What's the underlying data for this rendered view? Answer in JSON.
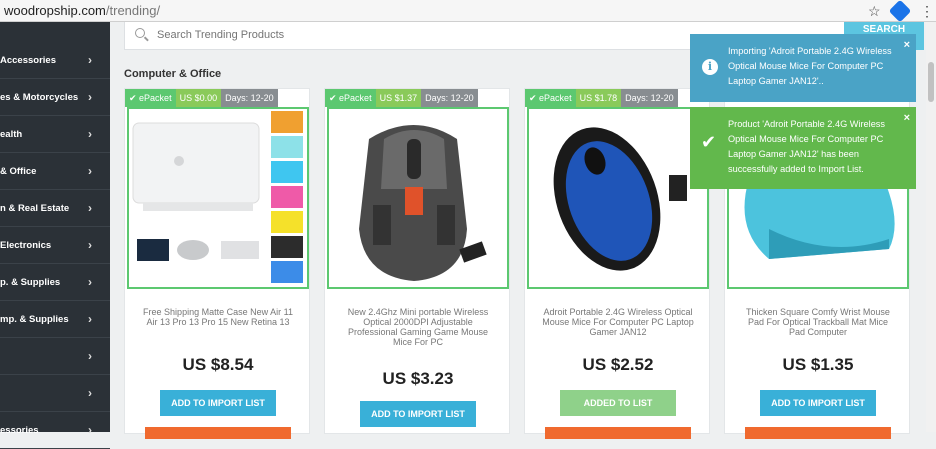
{
  "browser": {
    "url_host": "woodropship.com",
    "url_path": "/trending/",
    "star_icon": "star-icon",
    "menu_icon": "kebab-menu-icon"
  },
  "sidebar": {
    "items": [
      {
        "label": "Accessories"
      },
      {
        "label": "es & Motorcycles"
      },
      {
        "label": "ealth"
      },
      {
        "label": "& Office"
      },
      {
        "label": "n & Real Estate"
      },
      {
        "label": "Electronics"
      },
      {
        "label": "p. & Supplies"
      },
      {
        "label": "mp. & Supplies"
      },
      {
        "label": ""
      },
      {
        "label": ""
      },
      {
        "label": "essories"
      }
    ]
  },
  "search": {
    "placeholder": "Search Trending Products",
    "button_label": "SEARCH"
  },
  "section_title": "Computer & Office",
  "products": [
    {
      "epacket": "ePacket",
      "ship_price": "US $0.00",
      "days": "Days: 12-20",
      "name": "Free Shipping Matte Case New Air 11 Air 13 Pro 13 Pro 15 New Retina 13",
      "price": "US $8.54",
      "button": "ADD TO IMPORT LIST"
    },
    {
      "epacket": "ePacket",
      "ship_price": "US $1.37",
      "days": "Days: 12-20",
      "name": "New 2.4Ghz Mini portable Wireless Optical 2000DPI Adjustable Professional Gaming Game Mouse Mice For PC",
      "price": "US $3.23",
      "button": "ADD TO IMPORT LIST"
    },
    {
      "epacket": "ePacket",
      "ship_price": "US $1.78",
      "days": "Days: 12-20",
      "name": "Adroit Portable 2.4G Wireless Optical Mouse Mice For Computer PC Laptop Gamer JAN12",
      "price": "US $2.52",
      "button": "ADDED TO LIST"
    },
    {
      "epacket": "",
      "ship_price": "",
      "days": "",
      "name": "Thicken Square Comfy Wrist Mouse Pad For Optical Trackball Mat Mice Pad Computer",
      "price": "US $1.35",
      "button": "ADD TO IMPORT LIST"
    }
  ],
  "notifications": {
    "info": "Importing 'Adroit Portable 2.4G Wireless Optical Mouse Mice For Computer PC Laptop Gamer JAN12'..",
    "success": "Product 'Adroit Portable 2.4G Wireless Optical Mouse Mice For Computer PC Laptop Gamer JAN12' has been successfully added to Import List.",
    "close": "×"
  },
  "colors": {
    "sidebar_bg": "#2b3137",
    "accent_blue": "#39b0d8",
    "success_green": "#62b84c",
    "info_blue": "#4aa3c6",
    "card_border_green": "#5cc870"
  }
}
